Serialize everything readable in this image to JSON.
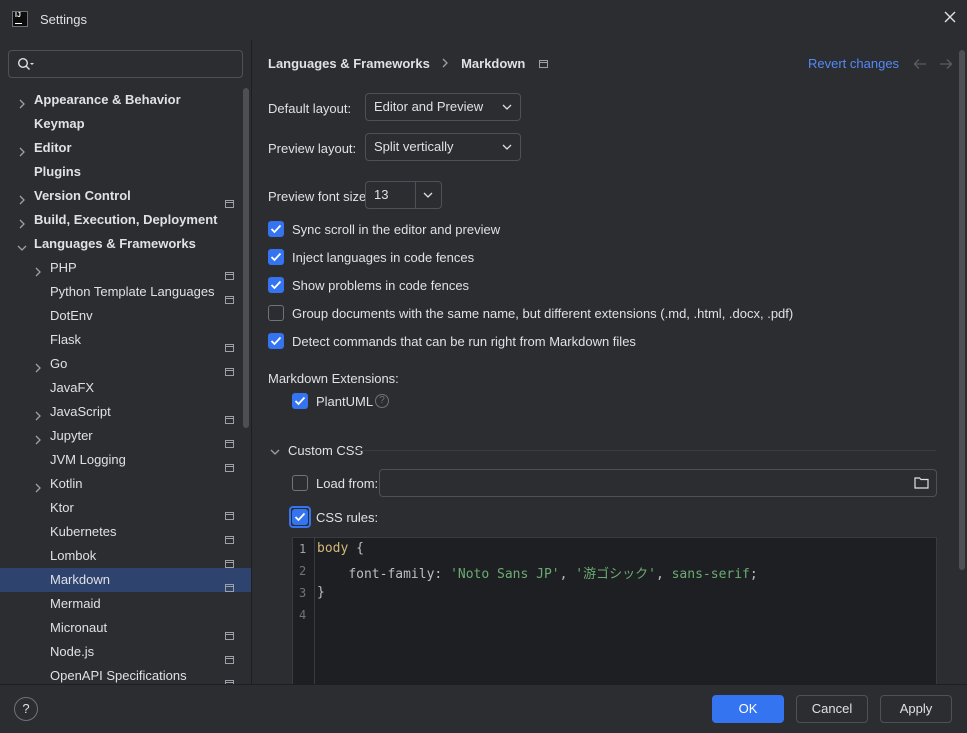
{
  "window": {
    "title": "Settings",
    "app_icon_text": "IJ"
  },
  "search": {
    "placeholder": ""
  },
  "tree": [
    {
      "label": "Appearance & Behavior",
      "level": 0,
      "expandable": true,
      "expanded": false,
      "project": false,
      "selected": false
    },
    {
      "label": "Keymap",
      "level": 0,
      "expandable": false,
      "project": false,
      "selected": false
    },
    {
      "label": "Editor",
      "level": 0,
      "expandable": true,
      "expanded": false,
      "project": false,
      "selected": false
    },
    {
      "label": "Plugins",
      "level": 0,
      "expandable": false,
      "project": false,
      "selected": false
    },
    {
      "label": "Version Control",
      "level": 0,
      "expandable": true,
      "expanded": false,
      "project": true,
      "selected": false
    },
    {
      "label": "Build, Execution, Deployment",
      "level": 0,
      "expandable": true,
      "expanded": false,
      "project": false,
      "selected": false
    },
    {
      "label": "Languages & Frameworks",
      "level": 0,
      "expandable": true,
      "expanded": true,
      "project": false,
      "selected": false
    },
    {
      "label": "PHP",
      "level": 1,
      "expandable": true,
      "expanded": false,
      "project": true,
      "selected": false
    },
    {
      "label": "Python Template Languages",
      "level": 1,
      "expandable": false,
      "project": true,
      "selected": false
    },
    {
      "label": "DotEnv",
      "level": 1,
      "expandable": false,
      "project": false,
      "selected": false
    },
    {
      "label": "Flask",
      "level": 1,
      "expandable": false,
      "project": true,
      "selected": false
    },
    {
      "label": "Go",
      "level": 1,
      "expandable": true,
      "expanded": false,
      "project": true,
      "selected": false
    },
    {
      "label": "JavaFX",
      "level": 1,
      "expandable": false,
      "project": false,
      "selected": false
    },
    {
      "label": "JavaScript",
      "level": 1,
      "expandable": true,
      "expanded": false,
      "project": true,
      "selected": false
    },
    {
      "label": "Jupyter",
      "level": 1,
      "expandable": true,
      "expanded": false,
      "project": true,
      "selected": false
    },
    {
      "label": "JVM Logging",
      "level": 1,
      "expandable": false,
      "project": true,
      "selected": false
    },
    {
      "label": "Kotlin",
      "level": 1,
      "expandable": true,
      "expanded": false,
      "project": false,
      "selected": false
    },
    {
      "label": "Ktor",
      "level": 1,
      "expandable": false,
      "project": true,
      "selected": false
    },
    {
      "label": "Kubernetes",
      "level": 1,
      "expandable": false,
      "project": true,
      "selected": false
    },
    {
      "label": "Lombok",
      "level": 1,
      "expandable": false,
      "project": true,
      "selected": false
    },
    {
      "label": "Markdown",
      "level": 1,
      "expandable": false,
      "project": true,
      "selected": true
    },
    {
      "label": "Mermaid",
      "level": 1,
      "expandable": false,
      "project": false,
      "selected": false
    },
    {
      "label": "Micronaut",
      "level": 1,
      "expandable": false,
      "project": true,
      "selected": false
    },
    {
      "label": "Node.js",
      "level": 1,
      "expandable": false,
      "project": true,
      "selected": false
    },
    {
      "label": "OpenAPI Specifications",
      "level": 1,
      "expandable": false,
      "project": true,
      "selected": false
    }
  ],
  "breadcrumb": {
    "parent": "Languages & Frameworks",
    "current": "Markdown"
  },
  "revert_label": "Revert changes",
  "settings": {
    "default_layout_label": "Default layout:",
    "default_layout_value": "Editor and Preview",
    "preview_layout_label": "Preview layout:",
    "preview_layout_value": "Split vertically",
    "font_size_label": "Preview font size:",
    "font_size_value": "13",
    "checkboxes": [
      {
        "label": "Sync scroll in the editor and preview",
        "checked": true
      },
      {
        "label": "Inject languages in code fences",
        "checked": true
      },
      {
        "label": "Show problems in code fences",
        "checked": true
      },
      {
        "label": "Group documents with the same name, but different extensions (.md, .html, .docx, .pdf)",
        "checked": false
      },
      {
        "label": "Detect commands that can be run right from Markdown files",
        "checked": true
      }
    ],
    "extensions_label": "Markdown Extensions:",
    "plantuml_label": "PlantUML",
    "plantuml_checked": true,
    "custom_css_label": "Custom CSS",
    "load_from_label": "Load from:",
    "load_from_checked": false,
    "load_from_value": "",
    "css_rules_label": "CSS rules:",
    "css_rules_checked": true
  },
  "editor": {
    "line_numbers": [
      "1",
      "2",
      "3",
      "4"
    ],
    "line1": {
      "selector": "body",
      "brace": " {"
    },
    "line2": {
      "indent": "    ",
      "property": "font-family",
      "colon": ": ",
      "s1": "'Noto Sans JP'",
      "c1": ", ",
      "s2": "'游ゴシック'",
      "c2": ", ",
      "s3": "sans-serif",
      "end": ";"
    },
    "line3": {
      "brace": "}"
    }
  },
  "buttons": {
    "ok": "OK",
    "cancel": "Cancel",
    "apply": "Apply",
    "help": "?"
  },
  "colors": {
    "accent": "#3574f0",
    "link": "#548af7",
    "selection": "#2e436e",
    "background": "#2b2d30"
  }
}
